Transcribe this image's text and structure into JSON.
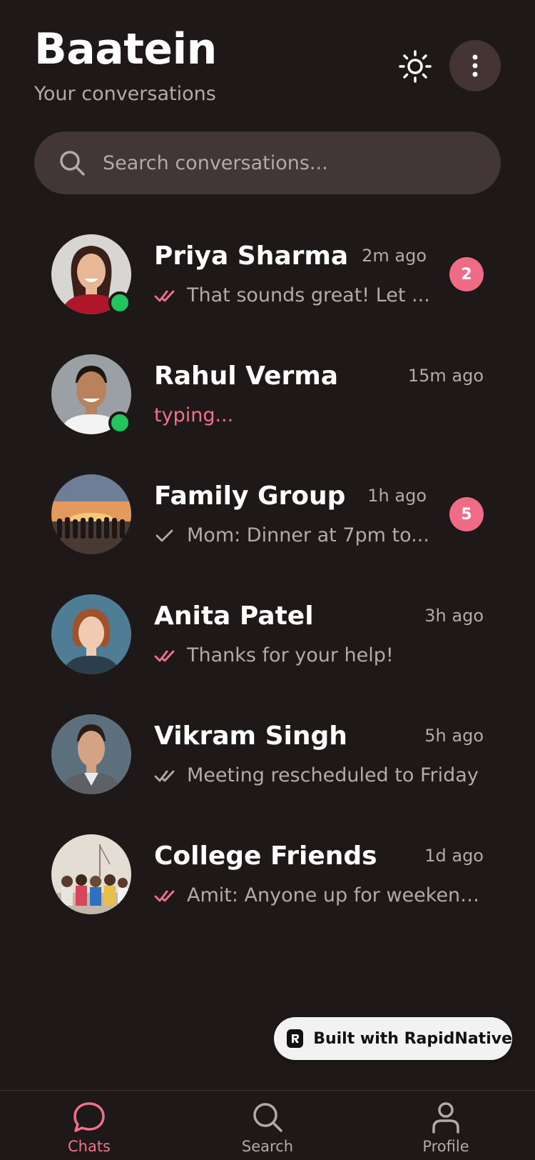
{
  "app": {
    "title": "Baatein",
    "subtitle": "Your conversations"
  },
  "search": {
    "placeholder": "Search conversations..."
  },
  "colors": {
    "background": "#1e1918",
    "accent": "#f0728a",
    "badge": "#f06b86",
    "online": "#22c55e",
    "muted_text": "#b3aaa8",
    "surface": "#433636"
  },
  "chats": [
    {
      "name": "Priya Sharma",
      "time": "2m ago",
      "preview": "That sounds great! Let ...",
      "status_icon": "double-check-read-icon",
      "unread": "2",
      "online": true
    },
    {
      "name": "Rahul Verma",
      "time": "15m ago",
      "preview": "typing...",
      "status_icon": "",
      "unread": "",
      "online": true
    },
    {
      "name": "Family Group",
      "time": "1h ago",
      "preview": "Mom: Dinner at 7pm to...",
      "status_icon": "single-check-icon",
      "unread": "5",
      "online": false
    },
    {
      "name": "Anita Patel",
      "time": "3h ago",
      "preview": "Thanks for your help!",
      "status_icon": "double-check-read-icon",
      "unread": "",
      "online": false
    },
    {
      "name": "Vikram Singh",
      "time": "5h ago",
      "preview": "Meeting rescheduled to Friday",
      "status_icon": "double-check-delivered-icon",
      "unread": "",
      "online": false
    },
    {
      "name": "College Friends",
      "time": "1d ago",
      "preview": "Amit: Anyone up for weekend ...",
      "status_icon": "double-check-read-icon",
      "unread": "",
      "online": false
    }
  ],
  "built_badge": {
    "label": "Built with RapidNative"
  },
  "nav": {
    "chats": "Chats",
    "search": "Search",
    "profile": "Profile"
  }
}
